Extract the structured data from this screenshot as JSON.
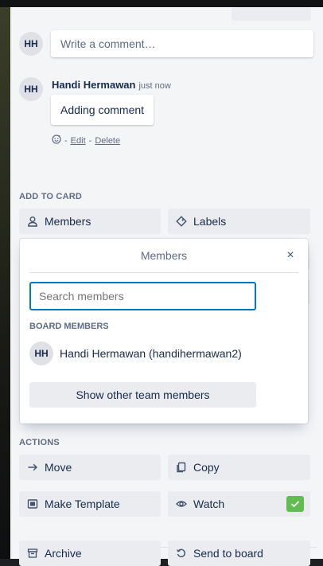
{
  "comment": {
    "avatar_initials": "HH",
    "placeholder": "Write a comment…"
  },
  "activity": {
    "avatar_initials": "HH",
    "author": "Handi Hermawan",
    "timestamp": "just now",
    "text": "Adding comment",
    "emoji_icon": "emoji-icon",
    "edit_label": "Edit",
    "delete_label": "Delete",
    "sep1": "-",
    "sep2": "-"
  },
  "add_to_card": {
    "heading": "ADD TO CARD",
    "members_label": "Members",
    "labels_label": "Labels"
  },
  "members_popover": {
    "title": "Members",
    "close_glyph": "×",
    "search_placeholder": "Search members",
    "section_heading": "BOARD MEMBERS",
    "members": [
      {
        "initials": "HH",
        "name": "Handi Hermawan (handihermawan2)"
      }
    ],
    "show_other_label": "Show other team members"
  },
  "actions": {
    "heading": "ACTIONS",
    "move_label": "Move",
    "copy_label": "Copy",
    "make_template_label": "Make Template",
    "watch_label": "Watch",
    "archive_label": "Archive",
    "send_to_board_label": "Send to board"
  },
  "colors": {
    "accent": "#0079bf",
    "watch_check": "#61bd4f",
    "panel_bg": "#f4f5f7",
    "button_bg": "#ebecf0"
  }
}
